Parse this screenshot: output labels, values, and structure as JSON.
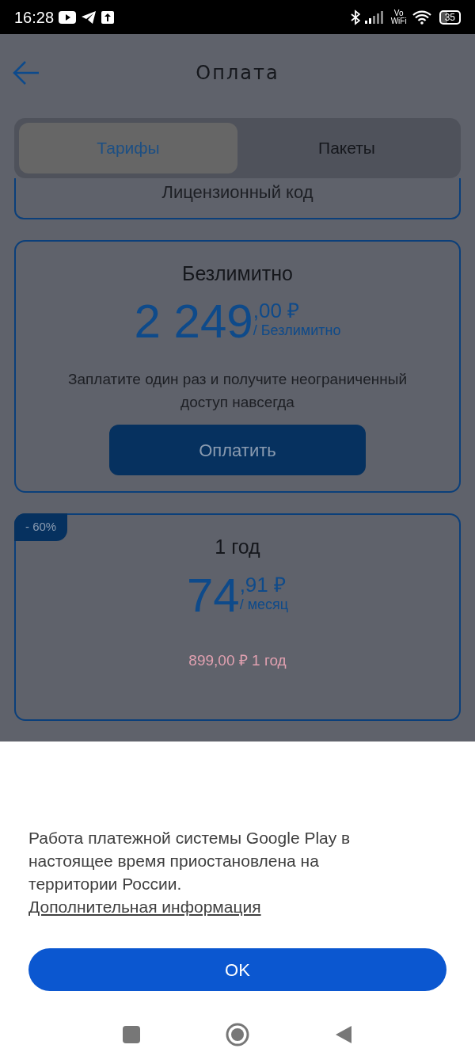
{
  "status_bar": {
    "time": "16:28",
    "network_label": "Vo WiFi",
    "battery": "35"
  },
  "header": {
    "title": "Оплата"
  },
  "tabs": [
    {
      "label": "Тарифы",
      "selected": true
    },
    {
      "label": "Пакеты",
      "selected": false
    }
  ],
  "license_code": {
    "label": "Лицензионный код"
  },
  "plans": [
    {
      "title": "Безлимитно",
      "price_main": "2 249",
      "price_fraction": ",00 ₽",
      "period": "/ Безлимитно",
      "description": "Заплатите один раз и получите неограниченный доступ навсегда",
      "button": "Оплатить"
    },
    {
      "badge": "- 60%",
      "title": "1 год",
      "price_main": "74",
      "price_fraction": ",91 ₽",
      "period": "/ месяц",
      "old_price": "899,00 ₽ 1 год"
    }
  ],
  "sheet": {
    "message": "Работа платежной системы Google Play в настоящее время приостановлена на территории России.",
    "link": "Дополнительная информация",
    "button": "OK"
  }
}
